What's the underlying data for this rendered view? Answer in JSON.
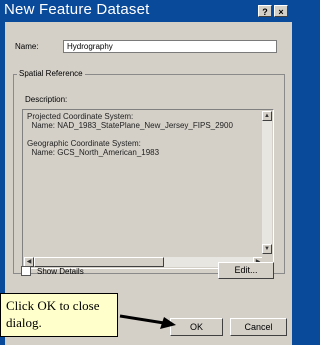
{
  "window": {
    "title": "New Feature Dataset",
    "help_btn": "?",
    "close_btn": "×"
  },
  "name_field": {
    "label": "Name:",
    "value": "Hydrography"
  },
  "spatial_reference": {
    "group_label": "Spatial Reference",
    "description_label": "Description:",
    "description_text": "Projected Coordinate System:\n  Name: NAD_1983_StatePlane_New_Jersey_FIPS_2900\n\nGeographic Coordinate System:\n  Name: GCS_North_American_1983"
  },
  "show_details": {
    "label": "Show Details",
    "checked": false
  },
  "buttons": {
    "edit": "Edit...",
    "ok": "OK",
    "cancel": "Cancel"
  },
  "callout": {
    "text": "Click OK to close dialog."
  },
  "colors": {
    "titlebar": "#0a4a9a",
    "dialog_face": "#d4d0c8",
    "callout_bg": "#ffffcc"
  }
}
